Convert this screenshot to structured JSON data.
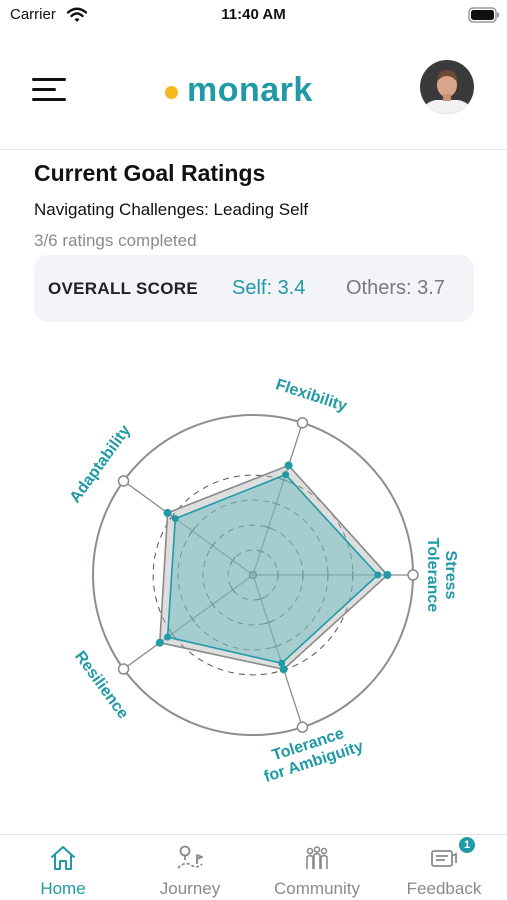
{
  "status_bar": {
    "carrier": "Carrier",
    "time": "11:40 AM"
  },
  "header": {
    "logo_text": "monark"
  },
  "goal": {
    "title": "Current Goal Ratings",
    "subtitle": "Navigating Challenges: Leading Self",
    "progress": "3/6 ratings completed"
  },
  "score": {
    "label": "OVERALL SCORE",
    "self": "Self: 3.4",
    "others": "Others: 3.7"
  },
  "colors": {
    "accent": "#1f9aa6",
    "logo_dot": "#f6b91a",
    "self_fill": "#5fb5bd",
    "others_fill": "#b5b5b5",
    "ring": "#8a8f94"
  },
  "chart_data": {
    "type": "radar",
    "axes": [
      {
        "label": [
          "Flexibility"
        ]
      },
      {
        "label": [
          "Stress",
          "Tolerance"
        ]
      },
      {
        "label": [
          "Tolerance",
          "for Ambiguity"
        ]
      },
      {
        "label": [
          "Resilience"
        ]
      },
      {
        "label": [
          "Adaptability"
        ]
      }
    ],
    "scale_max": 5,
    "ticks": [
      1,
      2,
      3,
      4
    ],
    "series": [
      {
        "key": "self",
        "values": [
          3.3,
          3.9,
          2.9,
          3.3,
          3.0
        ]
      },
      {
        "key": "others",
        "values": [
          3.6,
          4.2,
          3.1,
          3.6,
          3.3
        ]
      }
    ]
  },
  "tabs": [
    {
      "key": "home",
      "label": "Home",
      "icon": "home-icon",
      "active": true
    },
    {
      "key": "journey",
      "label": "Journey",
      "icon": "journey-icon"
    },
    {
      "key": "community",
      "label": "Community",
      "icon": "community-icon"
    },
    {
      "key": "feedback",
      "label": "Feedback",
      "icon": "feedback-icon",
      "badge": "1"
    }
  ]
}
